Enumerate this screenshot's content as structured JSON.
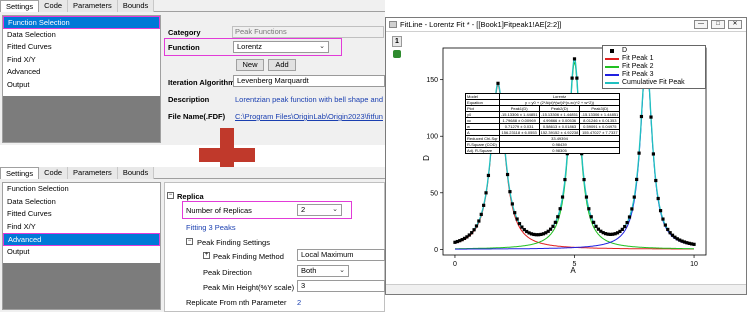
{
  "top_dialog": {
    "tabs": [
      "Settings",
      "Code",
      "Parameters",
      "Bounds"
    ],
    "tree_items": [
      "Function Selection",
      "Data Selection",
      "Fitted Curves",
      "Find X/Y",
      "Advanced",
      "Output"
    ],
    "selected_index": 0,
    "fields": {
      "category_label": "Category",
      "category_value": "Peak Functions",
      "function_label": "Function",
      "function_value": "Lorentz",
      "new_button": "New",
      "add_button": "Add",
      "iteration_label": "Iteration Algorithm",
      "iteration_value": "Levenberg Marquardt",
      "description_label": "Description",
      "description_value": "Lorentzian peak function with bell shape and r",
      "filename_label": "File Name(.FDF)",
      "filename_value": "C:\\Program Files\\OriginLab\\Origin2023\\fitfun"
    }
  },
  "bottom_dialog": {
    "tabs": [
      "Settings",
      "Code",
      "Parameters",
      "Bounds"
    ],
    "tree_items": [
      "Function Selection",
      "Data Selection",
      "Fitted Curves",
      "Find X/Y",
      "Advanced",
      "Output"
    ],
    "selected_index": 4,
    "replica": {
      "header": "Replica",
      "num_replicas_label": "Number of Replicas",
      "num_replicas_value": "2",
      "fitting_note": "Fitting 3 Peaks",
      "peak_finding_header": "Peak Finding Settings",
      "peak_method_label": "Peak Finding Method",
      "peak_method_value": "Local Maximum",
      "peak_direction_label": "Peak Direction",
      "peak_direction_value": "Both",
      "peak_min_label": "Peak Min Height(%Y scale)",
      "peak_min_value": "3",
      "replicate_label": "Replicate From nth Parameter",
      "replicate_value": "2"
    }
  },
  "graph_window": {
    "title": "FitLine - Lorentz Fit * - [[Book1]Fitpeak1!AE[2:2]]",
    "layer_number": "1",
    "buttons": [
      "—",
      "□",
      "✕"
    ],
    "legend": [
      {
        "label": "D",
        "color": "#000000",
        "kind": "square"
      },
      {
        "label": "Fit Peak 1",
        "color": "#e02020",
        "kind": "line"
      },
      {
        "label": "Fit Peak 2",
        "color": "#22c022",
        "kind": "line"
      },
      {
        "label": "Fit Peak 3",
        "color": "#2020e0",
        "kind": "line"
      },
      {
        "label": "Cumulative Fit Peak",
        "color": "#20c0c0",
        "kind": "line"
      }
    ],
    "xlabel": "A",
    "ylabel": "D",
    "xticks": [
      "0",
      "5",
      "10"
    ],
    "yticks": [
      "0",
      "50",
      "100",
      "150"
    ],
    "table": {
      "rows": [
        [
          "Model",
          "Lorentz"
        ],
        [
          "Equation",
          "y = y0 + (2*A/pi)*(w/(4*(x-xc)^2 + w^2))"
        ],
        [
          "Plot",
          "Peak1(D)",
          "Peak2(D)",
          "Peak3(D)"
        ],
        [
          "y0",
          "-15.13306 ± 1.44851",
          "-15.13306 ± 1.44851",
          "-15.13306 ± 1.44851"
        ],
        [
          "xc",
          "1.79688 ± 0.00969",
          "4.99866 ± 0.00536",
          "8.01246 ± 0.01353"
        ],
        [
          "w",
          "0.71279 ± 0.031",
          "0.58613 ± 0.01863",
          "0.59091 ± 0.04975"
        ],
        [
          "A",
          "156.23118 ± 6.0553",
          "152.39152 ± 4.92238",
          "155.47027 ± 7.7337"
        ],
        [
          "Reduced Chi-Sqr",
          "33.49394"
        ],
        [
          "R-Square (COD)",
          "0.98439"
        ],
        [
          "Adj. R-Square",
          "0.98305"
        ]
      ]
    }
  },
  "chart_data": {
    "type": "scatter",
    "xlabel": "A",
    "ylabel": "D",
    "xlim": [
      -0.5,
      10.5
    ],
    "ylim": [
      -5,
      178
    ],
    "peaks": [
      {
        "name": "Fit Peak 1",
        "xc": 1.8,
        "w": 0.71,
        "amp": 145,
        "color": "#e02020"
      },
      {
        "name": "Fit Peak 2",
        "xc": 5.0,
        "w": 0.59,
        "amp": 165,
        "color": "#22c022"
      },
      {
        "name": "Fit Peak 3",
        "xc": 8.0,
        "w": 0.59,
        "amp": 168,
        "color": "#2020e0"
      }
    ],
    "baseline": 0,
    "data_series_name": "D",
    "cumulative_color": "#20c0c0"
  },
  "colors": {
    "selection": "#0078d7",
    "highlight": "#e23bd8",
    "plus": "#c0392b",
    "link_blue": "#1a3fb0"
  }
}
